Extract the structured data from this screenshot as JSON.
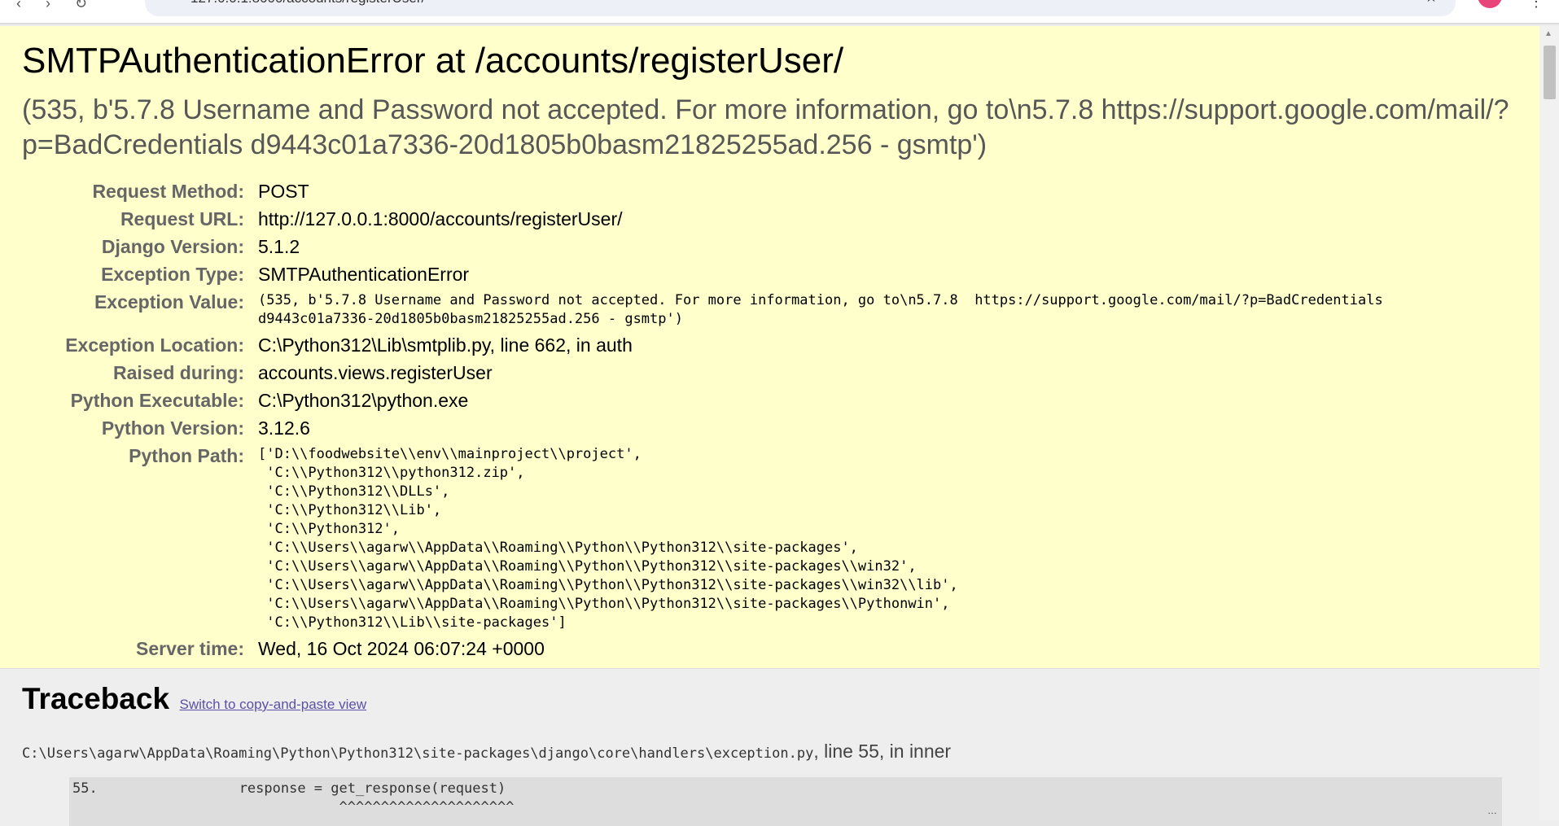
{
  "browser": {
    "url": "127.0.0.1:8000/accounts/registerUser/"
  },
  "title": "SMTPAuthenticationError at /accounts/registerUser/",
  "subtitle": "(535, b'5.7.8 Username and Password not accepted. For more information, go to\\n5.7.8 https://support.google.com/mail/?p=BadCredentials d9443c01a7336-20d1805b0basm21825255ad.256 - gsmtp')",
  "meta": [
    {
      "label": "Request Method:",
      "value": "POST"
    },
    {
      "label": "Request URL:",
      "value": "http://127.0.0.1:8000/accounts/registerUser/"
    },
    {
      "label": "Django Version:",
      "value": "5.1.2"
    },
    {
      "label": "Exception Type:",
      "value": "SMTPAuthenticationError"
    },
    {
      "label": "Exception Value:",
      "value": "(535, b'5.7.8 Username and Password not accepted. For more information, go to\\n5.7.8  https://support.google.com/mail/?p=BadCredentials\nd9443c01a7336-20d1805b0basm21825255ad.256 - gsmtp')"
    },
    {
      "label": "Exception Location:",
      "value": "C:\\Python312\\Lib\\smtplib.py, line 662, in auth"
    },
    {
      "label": "Raised during:",
      "value": "accounts.views.registerUser"
    },
    {
      "label": "Python Executable:",
      "value": "C:\\Python312\\python.exe"
    },
    {
      "label": "Python Version:",
      "value": "3.12.6"
    },
    {
      "label": "Python Path:",
      "value": "['D:\\\\foodwebsite\\\\env\\\\mainproject\\\\project',\n 'C:\\\\Python312\\\\python312.zip',\n 'C:\\\\Python312\\\\DLLs',\n 'C:\\\\Python312\\\\Lib',\n 'C:\\\\Python312',\n 'C:\\\\Users\\\\agarw\\\\AppData\\\\Roaming\\\\Python\\\\Python312\\\\site-packages',\n 'C:\\\\Users\\\\agarw\\\\AppData\\\\Roaming\\\\Python\\\\Python312\\\\site-packages\\\\win32',\n 'C:\\\\Users\\\\agarw\\\\AppData\\\\Roaming\\\\Python\\\\Python312\\\\site-packages\\\\win32\\\\lib',\n 'C:\\\\Users\\\\agarw\\\\AppData\\\\Roaming\\\\Python\\\\Python312\\\\site-packages\\\\Pythonwin',\n 'C:\\\\Python312\\\\Lib\\\\site-packages']"
    },
    {
      "label": "Server time:",
      "value": "Wed, 16 Oct 2024 06:07:24 +0000"
    }
  ],
  "traceback": {
    "heading": "Traceback",
    "switch_link": "Switch to copy-and-paste view",
    "frame_file": "C:\\Users\\agarw\\AppData\\Roaming\\Python\\Python312\\site-packages\\django\\core\\handlers\\exception.py",
    "frame_loc": ", line 55, in inner",
    "code": "55.                 response = get_response(request)\n                                ^^^^^^^^^^^^^^^^^^^^^"
  }
}
